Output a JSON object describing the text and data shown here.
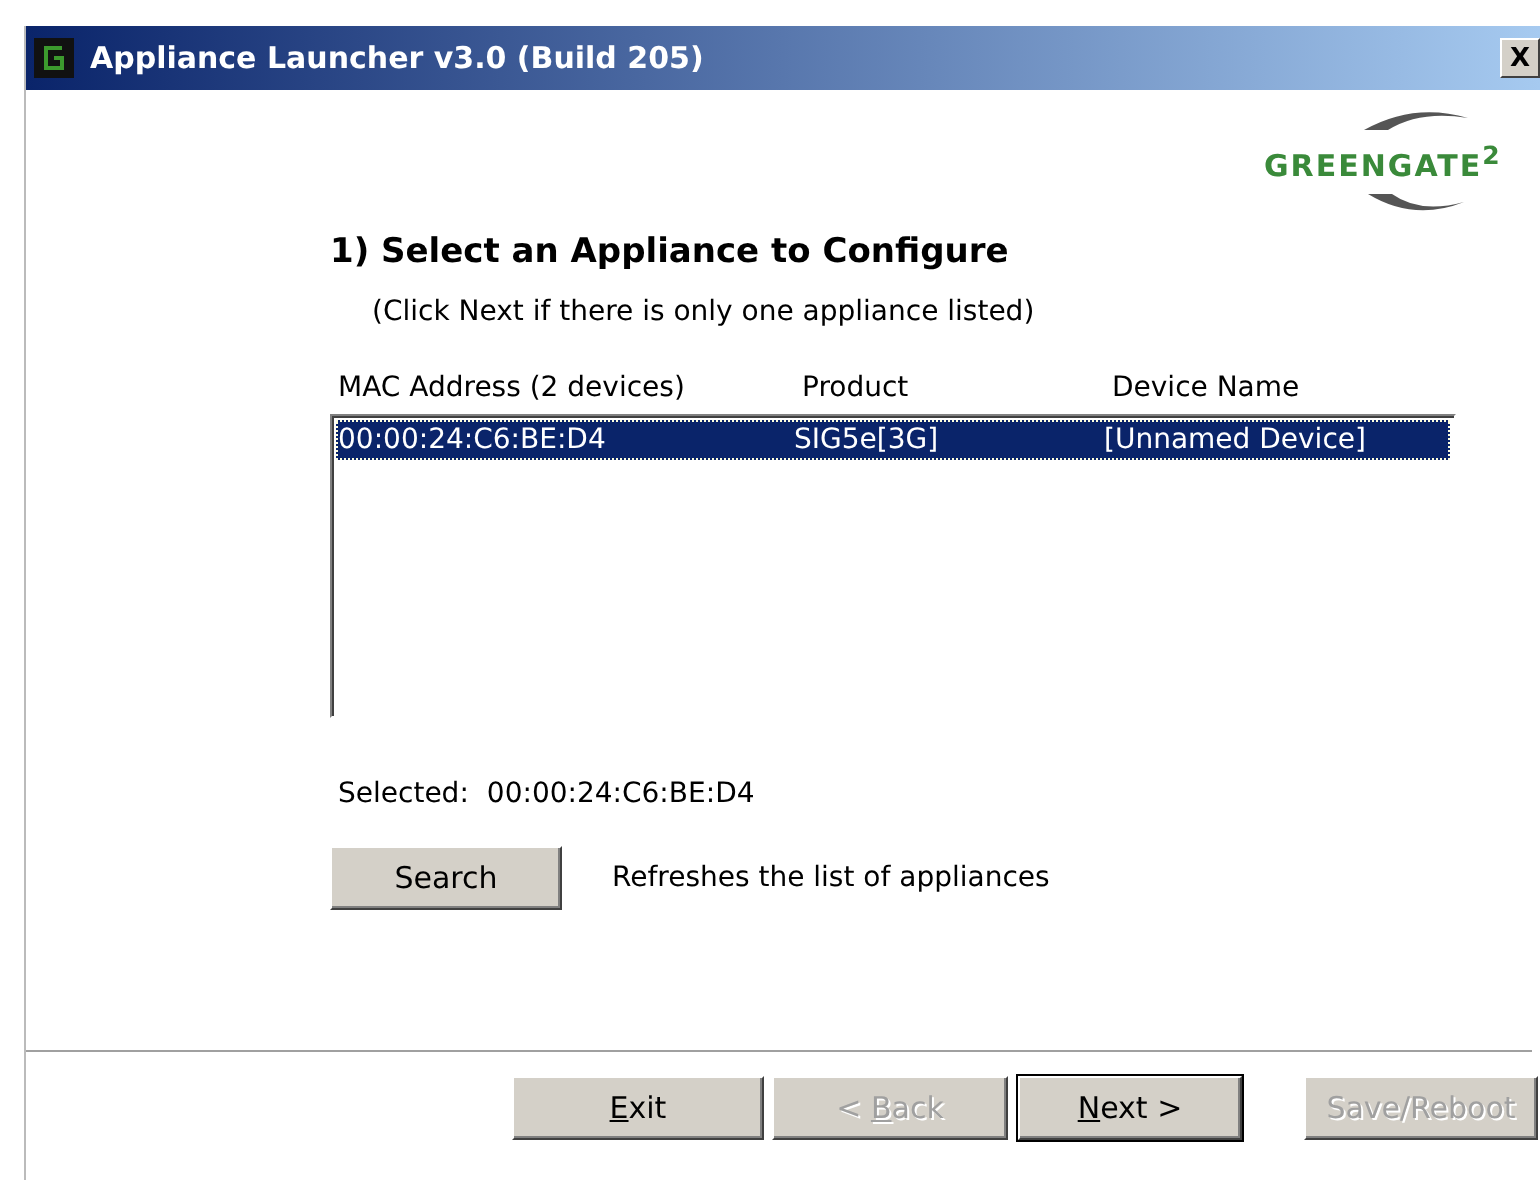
{
  "window": {
    "title": "Appliance Launcher v3.0 (Build 205)",
    "close": "X"
  },
  "logo": {
    "text": "GREENGATE$^{2}$"
  },
  "heading": "1) Select an Appliance to Configure",
  "hint": "(Click Next if there is only one appliance listed)",
  "table": {
    "columns": [
      "MAC Address (2 devices)",
      "Product",
      "Device Name"
    ],
    "rows": [
      {
        "cells": [
          "00:00:24:C6:BE:D4",
          "SIG5e[3G]",
          "[Unnamed Device]"
        ],
        "selected": true
      }
    ]
  },
  "selected_label": "Selected:",
  "selected_value": "00:00:24:C6:BE:D4",
  "search": {
    "label": "Search",
    "description": "Refreshes the list of appliances"
  },
  "buttons": [
    {
      "mnemonic": "E",
      "label_after": "xit",
      "disabled": false,
      "default": false
    },
    {
      "label_before": "< ",
      "mnemonic": "B",
      "label_after": "ack",
      "disabled": true,
      "default": false
    },
    {
      "mnemonic": "N",
      "label_after": "ext >",
      "disabled": false,
      "default": true
    },
    {
      "label_before": "Save/Reboot",
      "disabled": true,
      "default": false
    }
  ]
}
